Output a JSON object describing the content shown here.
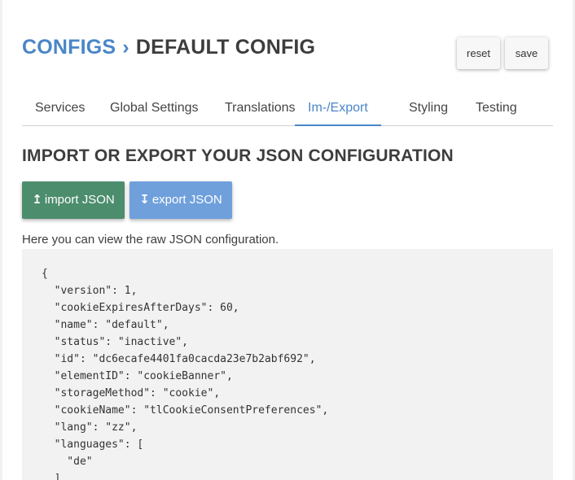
{
  "header": {
    "crumb_link": "CONFIGS",
    "separator": "›",
    "current": "DEFAULT CONFIG"
  },
  "actions": {
    "reset_label": "reset",
    "save_label": "save"
  },
  "tabs": [
    {
      "label": "Services",
      "active": false
    },
    {
      "label": "Global Settings",
      "active": false
    },
    {
      "label": "Translations",
      "active": false
    },
    {
      "label": "Im-/Export",
      "active": true
    },
    {
      "label": "Styling",
      "active": false
    },
    {
      "label": "Testing",
      "active": false
    }
  ],
  "section": {
    "title": "IMPORT OR EXPORT YOUR JSON CONFIGURATION",
    "import_arrow": "↥",
    "import_label": "import JSON",
    "export_arrow": "↧",
    "export_label": "export JSON",
    "description": "Here you can view the raw JSON configuration."
  },
  "code_lines": [
    "{",
    "  \"version\": 1,",
    "  \"cookieExpiresAfterDays\": 60,",
    "  \"name\": \"default\",",
    "  \"status\": \"inactive\",",
    "  \"id\": \"dc6ecafe4401fa0cacda23e7b2abf692\",",
    "  \"elementID\": \"cookieBanner\",",
    "  \"storageMethod\": \"cookie\",",
    "  \"cookieName\": \"tlCookieConsentPreferences\",",
    "  \"lang\": \"zz\",",
    "  \"languages\": [",
    "    \"de\"",
    "  ],"
  ],
  "colors": {
    "accent": "#4a86c8",
    "import_button": "#4c8d6d",
    "export_button": "#6fa0dc",
    "code_background": "#f2f2f2"
  }
}
